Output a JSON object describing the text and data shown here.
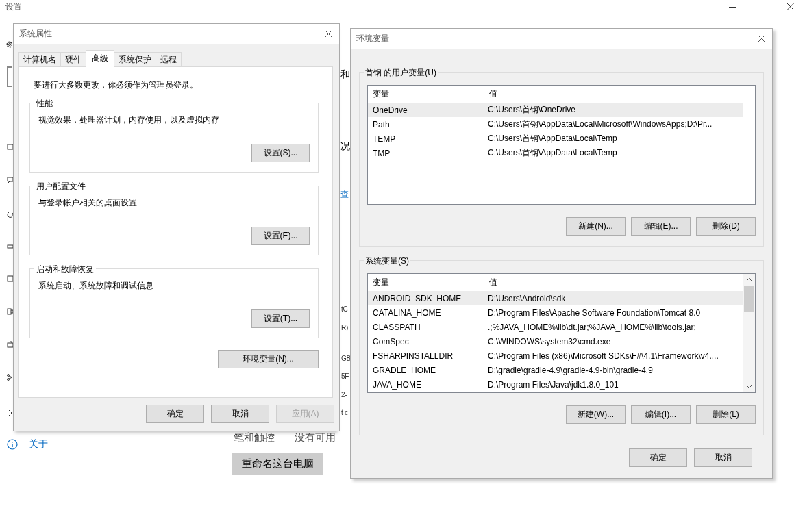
{
  "background_window": {
    "title": "设置",
    "fragments": [
      {
        "text": "和",
        "kind": "heading"
      },
      {
        "text": "况",
        "kind": "heading"
      },
      {
        "text": "查",
        "kind": "link"
      },
      {
        "text": "tC",
        "kind": "value"
      },
      {
        "text": "R)",
        "kind": "value"
      },
      {
        "text": "GB",
        "kind": "value"
      },
      {
        "text": "5F",
        "kind": "value"
      },
      {
        "text": "2-",
        "kind": "value"
      },
      {
        "text": "t c",
        "kind": "value"
      }
    ],
    "pen_label": "笔和触控",
    "pen_value": "没有可用",
    "about_link": "关于",
    "rename_button": "重命名这台电脑"
  },
  "system_properties": {
    "title": "系统属性",
    "tabs": [
      {
        "label": "计算机名",
        "selected": false
      },
      {
        "label": "硬件",
        "selected": false
      },
      {
        "label": "高级",
        "selected": true
      },
      {
        "label": "系统保护",
        "selected": false
      },
      {
        "label": "远程",
        "selected": false
      }
    ],
    "admin_note": "要进行大多数更改，你必须作为管理员登录。",
    "groups": [
      {
        "title": "性能",
        "description": "视觉效果，处理器计划，内存使用，以及虚拟内存",
        "button": "设置(S)..."
      },
      {
        "title": "用户配置文件",
        "description": "与登录帐户相关的桌面设置",
        "button": "设置(E)..."
      },
      {
        "title": "启动和故障恢复",
        "description": "系统启动、系统故障和调试信息",
        "button": "设置(T)..."
      }
    ],
    "env_button": "环境变量(N)...",
    "buttons": [
      {
        "label": "确定",
        "disabled": false
      },
      {
        "label": "取消",
        "disabled": false
      },
      {
        "label": "应用(A)",
        "disabled": true
      }
    ]
  },
  "environment_variables": {
    "title": "环境变量",
    "user_variables": {
      "title": "首钢 的用户变量(U)",
      "columns": [
        "变量",
        "值"
      ],
      "rows": [
        {
          "name": "OneDrive",
          "value": "C:\\Users\\首钢\\OneDrive",
          "selected": true
        },
        {
          "name": "Path",
          "value": "C:\\Users\\首钢\\AppData\\Local\\Microsoft\\WindowsApps;D:\\Pr...",
          "selected": false
        },
        {
          "name": "TEMP",
          "value": "C:\\Users\\首钢\\AppData\\Local\\Temp",
          "selected": false
        },
        {
          "name": "TMP",
          "value": "C:\\Users\\首钢\\AppData\\Local\\Temp",
          "selected": false
        }
      ],
      "buttons": [
        "新建(N)...",
        "编辑(E)...",
        "删除(D)"
      ]
    },
    "system_variables": {
      "title": "系统变量(S)",
      "columns": [
        "变量",
        "值"
      ],
      "rows": [
        {
          "name": "ANDROID_SDK_HOME",
          "value": "D:\\Users\\Android\\sdk",
          "selected": true
        },
        {
          "name": "CATALINA_HOME",
          "value": "D:\\Program Files\\Apache Software Foundation\\Tomcat 8.0",
          "selected": false
        },
        {
          "name": "CLASSPATH",
          "value": ".;%JAVA_HOME%\\lib\\dt.jar;%JAVA_HOME%\\lib\\tools.jar;",
          "selected": false
        },
        {
          "name": "ComSpec",
          "value": "C:\\WINDOWS\\system32\\cmd.exe",
          "selected": false
        },
        {
          "name": "FSHARPINSTALLDIR",
          "value": "C:\\Program Files (x86)\\Microsoft SDKs\\F#\\4.1\\Framework\\v4....",
          "selected": false
        },
        {
          "name": "GRADLE_HOME",
          "value": "D:\\gradle\\gradle-4.9\\gradle-4.9-bin\\gradle-4.9",
          "selected": false
        },
        {
          "name": "JAVA_HOME",
          "value": "D:\\Program Files\\Java\\jdk1.8.0_101",
          "selected": false
        }
      ],
      "buttons": [
        "新建(W)...",
        "编辑(I)...",
        "删除(L)"
      ]
    },
    "buttons": [
      "确定",
      "取消"
    ]
  }
}
